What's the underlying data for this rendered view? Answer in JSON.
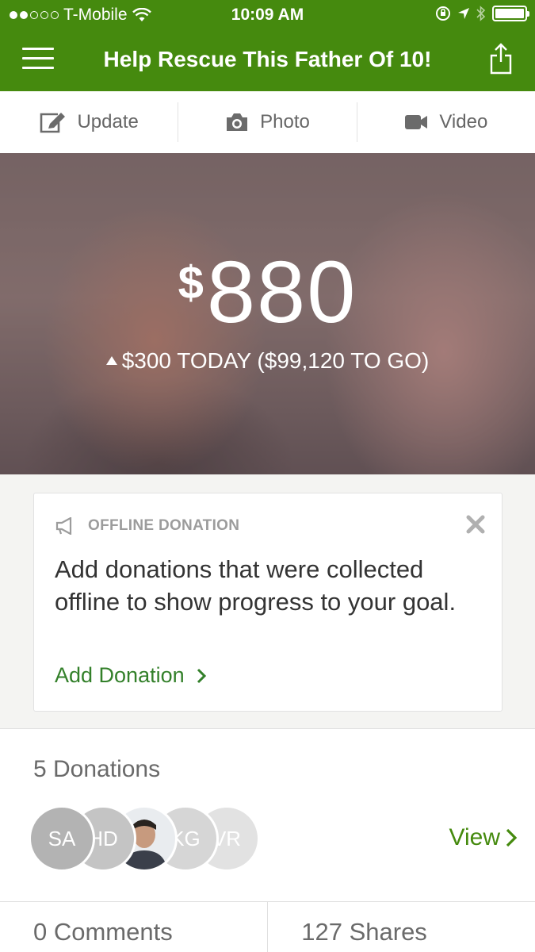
{
  "status_bar": {
    "carrier": "T-Mobile",
    "time": "10:09 AM"
  },
  "nav": {
    "title": "Help Rescue This Father Of 10!"
  },
  "compose": {
    "update_label": "Update",
    "photo_label": "Photo",
    "video_label": "Video"
  },
  "hero": {
    "currency": "$",
    "amount": "880",
    "today": "$300 TODAY",
    "to_go": "($99,120 TO GO)"
  },
  "offline_card": {
    "heading": "OFFLINE DONATION",
    "body": "Add donations that were collected offline to show progress to your goal.",
    "link_label": "Add Donation"
  },
  "donations": {
    "count_label": "5 Donations",
    "avatars": [
      {
        "initials": "SA",
        "color": "#b3b3b3"
      },
      {
        "initials": "HD",
        "color": "#c4c4c4"
      },
      {
        "initials": "",
        "color": "#ffffff"
      },
      {
        "initials": "KG",
        "color": "#d6d6d6"
      },
      {
        "initials": "VR",
        "color": "#e2e2e2"
      }
    ],
    "view_label": "View"
  },
  "stats": {
    "comments": "0 Comments",
    "shares": "127 Shares"
  },
  "colors": {
    "brand_green": "#458a0e",
    "link_green": "#33802a"
  }
}
